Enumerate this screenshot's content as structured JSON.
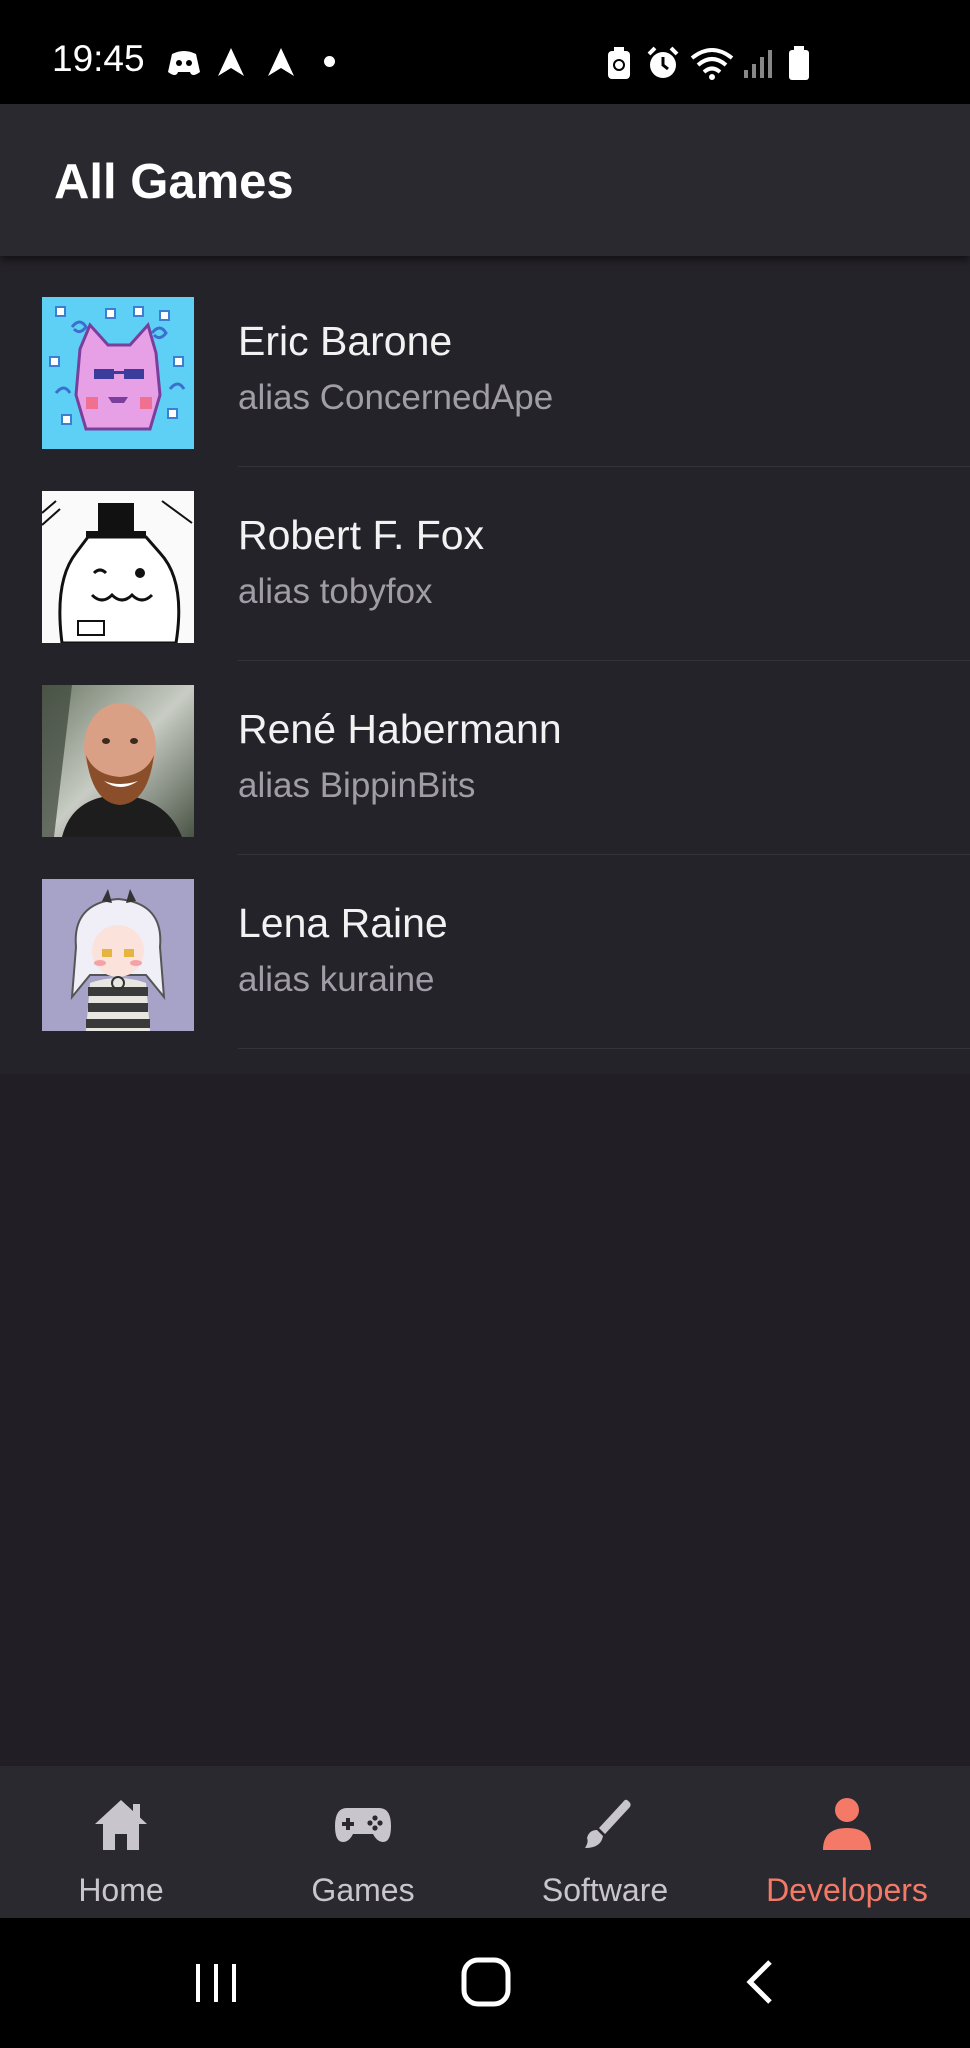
{
  "status_bar": {
    "time": "19:45",
    "icons": [
      "discord-icon",
      "send-icon",
      "send-icon",
      "dot-icon",
      "battery-saver-icon",
      "alarm-icon",
      "wifi-icon",
      "signal-icon",
      "battery-icon"
    ]
  },
  "app_bar": {
    "title": "All Games"
  },
  "developers": [
    {
      "name": "Eric Barone",
      "alias": "alias ConcernedApe",
      "avatar": "pixel-cat-avatar"
    },
    {
      "name": "Robert F. Fox",
      "alias": "alias tobyfox",
      "avatar": "dog-sketch-avatar"
    },
    {
      "name": "René Habermann",
      "alias": "alias BippinBits",
      "avatar": "photo-avatar"
    },
    {
      "name": "Lena Raine",
      "alias": "alias kuraine",
      "avatar": "pixel-girl-avatar"
    }
  ],
  "bottom_nav": {
    "items": [
      {
        "label": "Home",
        "icon": "home-icon",
        "active": false
      },
      {
        "label": "Games",
        "icon": "gamepad-icon",
        "active": false
      },
      {
        "label": "Software",
        "icon": "brush-icon",
        "active": false
      },
      {
        "label": "Developers",
        "icon": "person-icon",
        "active": true
      }
    ],
    "active_color": "#f47a67",
    "inactive_color": "#c8c6cc"
  },
  "system_nav": {
    "buttons": [
      "recents-button",
      "home-button",
      "back-button"
    ]
  },
  "colors": {
    "background": "#211f25",
    "app_bar": "#2a2930",
    "list_card": "#25232a",
    "accent": "#f47a67"
  }
}
